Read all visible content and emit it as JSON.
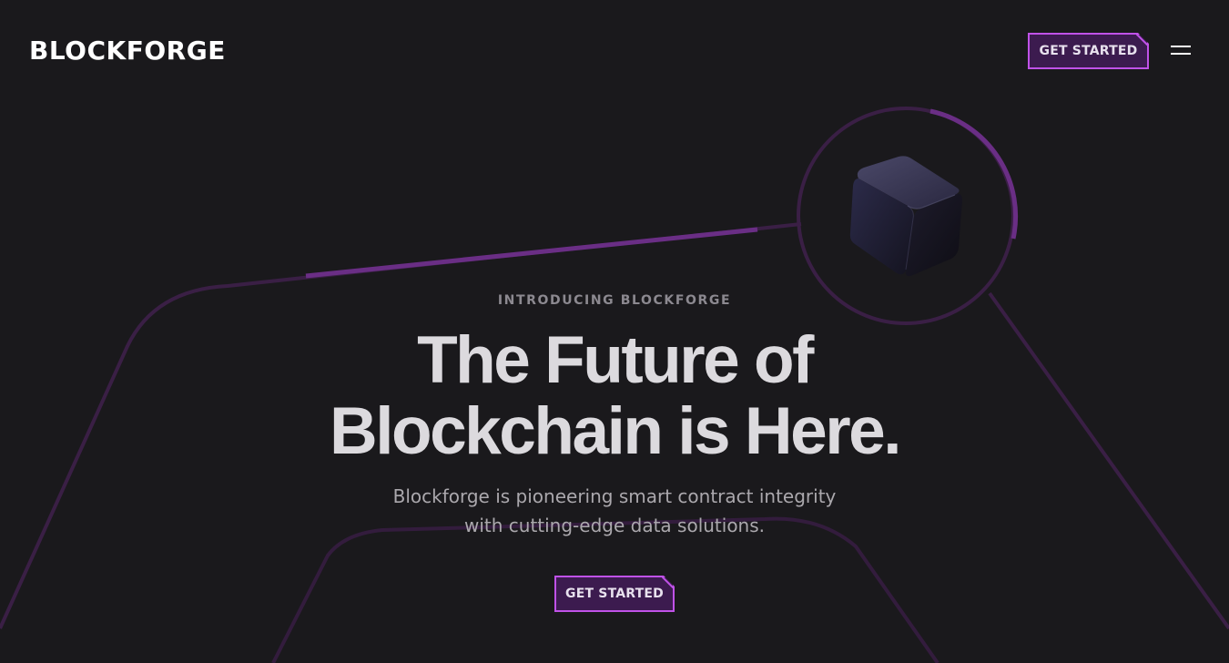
{
  "header": {
    "logo": "BLOCKFORGE",
    "cta_label": "GET STARTED",
    "menu_icon": "hamburger-menu-icon"
  },
  "hero": {
    "eyebrow": "INTRODUCING BLOCKFORGE",
    "headline_line1": "The Future of",
    "headline_line2": "Blockchain is Here.",
    "subtitle_line1": "Blockforge is pioneering smart contract integrity",
    "subtitle_line2": "with cutting-edge data solutions.",
    "cta_label": "GET STARTED",
    "illustration": "cube-icon"
  },
  "colors": {
    "background": "#1a191c",
    "accent": "#c052e8",
    "accent_fill": "#3c1b4f",
    "line": "#3d2146",
    "line_highlight": "#6b2f86",
    "headline": "#dcdade",
    "muted": "#8c8990"
  }
}
